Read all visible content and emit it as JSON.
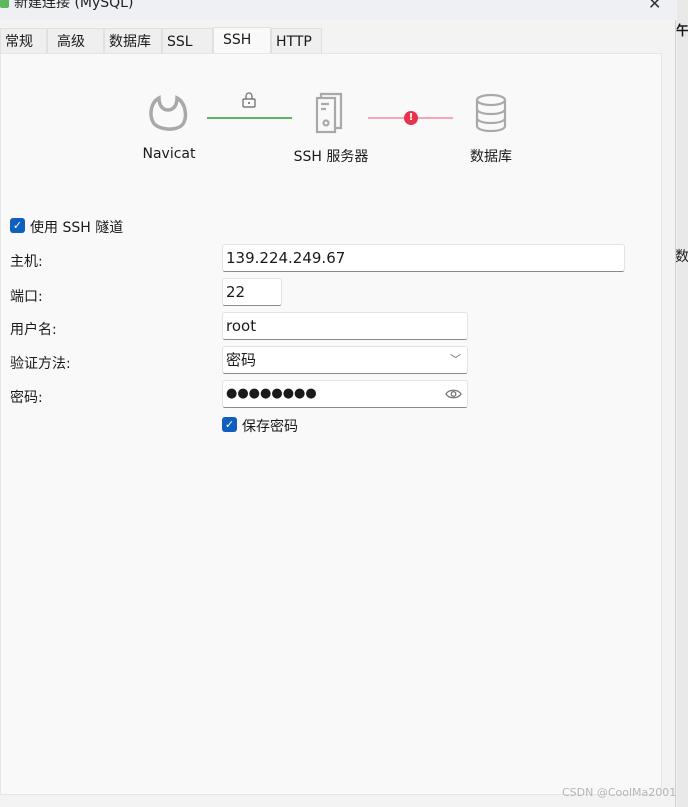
{
  "window": {
    "title": "新建连接 (MySQL)",
    "close_icon": "close-icon"
  },
  "tabs": [
    {
      "label": "常规"
    },
    {
      "label": "高级"
    },
    {
      "label": "数据库"
    },
    {
      "label": "SSL"
    },
    {
      "label": "SSH",
      "active": true
    },
    {
      "label": "HTTP"
    }
  ],
  "diagram": {
    "nodes": [
      "Navicat",
      "SSH 服务器",
      "数据库"
    ],
    "link1_color": "#5cb85c",
    "link2_color": "#f4a7b5",
    "error_color": "#e8334f"
  },
  "ssh": {
    "use_tunnel_label": "使用 SSH 隧道",
    "use_tunnel": true,
    "host_label": "主机:",
    "host": "139.224.249.67",
    "port_label": "端口:",
    "port": "22",
    "user_label": "用户名:",
    "user": "root",
    "auth_label": "验证方法:",
    "auth": "密码",
    "password_label": "密码:",
    "password": "●●●●●●●●",
    "save_password_label": "保存密码",
    "save_password": true
  },
  "background": {
    "char1": "午",
    "char2": "数"
  },
  "watermark": "CSDN @CoolMa2001",
  "accent": "#0f5fbf"
}
